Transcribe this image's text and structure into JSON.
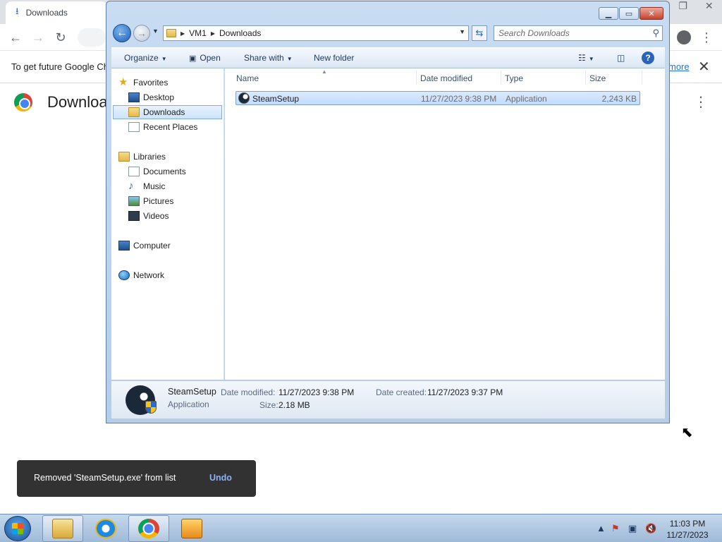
{
  "chrome": {
    "tab_title": "Downloads",
    "infobar_text": "To get future Google Ch",
    "infobar_more": "more",
    "page_title": "Downloa"
  },
  "explorer": {
    "breadcrumb": [
      "VM1",
      "Downloads"
    ],
    "search_placeholder": "Search Downloads",
    "commands": {
      "organize": "Organize",
      "open": "Open",
      "share_with": "Share with",
      "new_folder": "New folder"
    },
    "nav": {
      "favorites": "Favorites",
      "desktop": "Desktop",
      "downloads": "Downloads",
      "recent_places": "Recent Places",
      "libraries": "Libraries",
      "documents": "Documents",
      "music": "Music",
      "pictures": "Pictures",
      "videos": "Videos",
      "computer": "Computer",
      "network": "Network"
    },
    "columns": {
      "name": "Name",
      "date_modified": "Date modified",
      "type": "Type",
      "size": "Size"
    },
    "files": [
      {
        "name": "SteamSetup",
        "date_modified": "11/27/2023 9:38 PM",
        "type": "Application",
        "size": "2,243 KB"
      }
    ],
    "details": {
      "name": "SteamSetup",
      "type": "Application",
      "date_modified_label": "Date modified:",
      "date_modified": "11/27/2023 9:38 PM",
      "date_created_label": "Date created:",
      "date_created": "11/27/2023 9:37 PM",
      "size_label": "Size:",
      "size": "2.18 MB"
    }
  },
  "snackbar": {
    "message": "Removed 'SteamSetup.exe' from list",
    "action": "Undo"
  },
  "taskbar": {
    "time": "11:03 PM",
    "date": "11/27/2023"
  }
}
